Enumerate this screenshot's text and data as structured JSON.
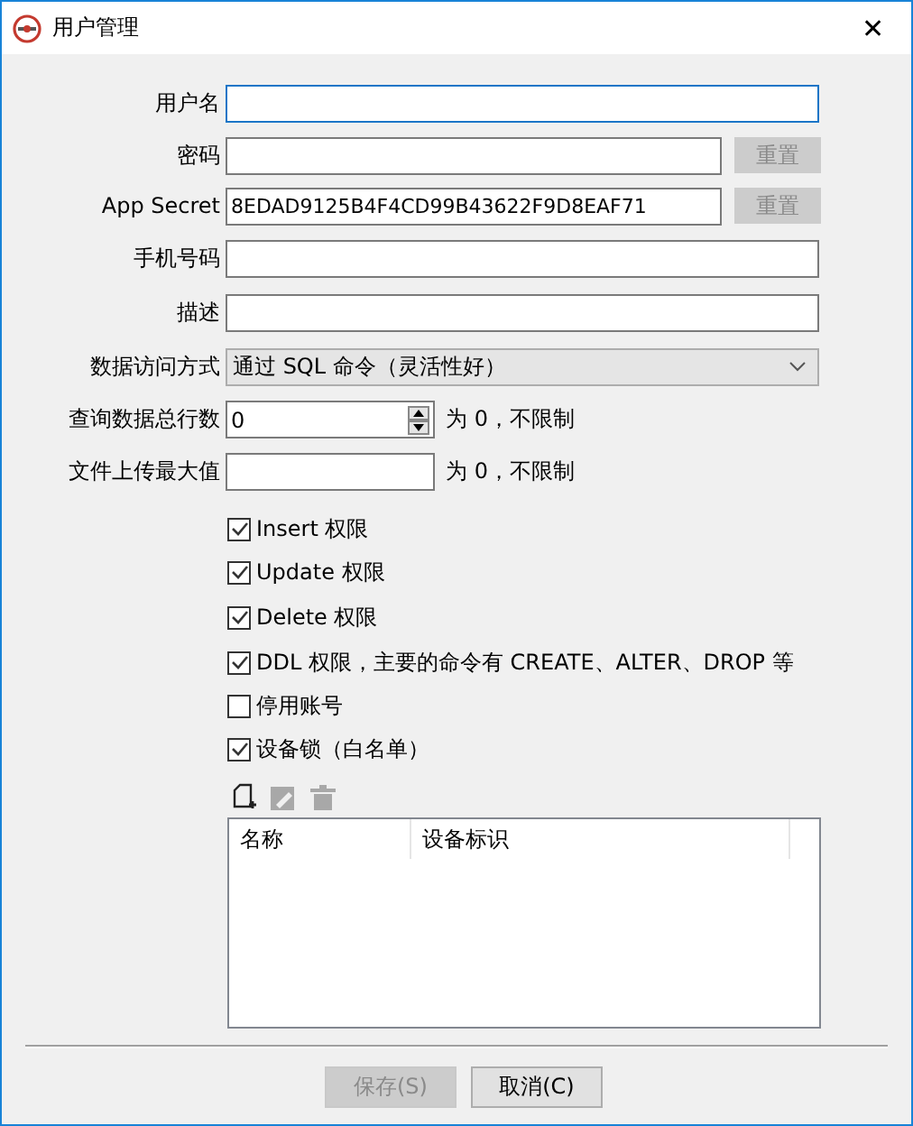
{
  "window": {
    "title": "用户管理",
    "close": "✕"
  },
  "fields": [
    {
      "kind": "text",
      "label": "用户名",
      "focused": true
    },
    {
      "kind": "button",
      "label": "密码",
      "button": {
        "label": "重置",
        "disabled": true
      }
    },
    {
      "kind": "button",
      "label": "App Secret",
      "value": "8EDAD9125B4F4CD99B43622F9D8EAF71",
      "button": {
        "label": "重置",
        "disabled": true
      }
    },
    {
      "kind": "text",
      "label": "手机号码"
    },
    {
      "kind": "text",
      "label": "描述"
    },
    {
      "kind": "combo",
      "label": "数据访问方式",
      "value": "通过 SQL 命令（灵活性好）"
    },
    {
      "kind": "spinner",
      "label": "查询数据总行数",
      "value": "0",
      "hint": "为 0，不限制"
    },
    {
      "kind": "text",
      "label": "文件上传最大值",
      "hint": "为 0，不限制"
    }
  ],
  "checkboxes": [
    {
      "label": "Insert 权限",
      "checked": true
    },
    {
      "label": "Update 权限",
      "checked": true
    },
    {
      "label": "Delete 权限",
      "checked": true
    },
    {
      "label": "DDL 权限，主要的命令有 CREATE、ALTER、DROP 等",
      "checked": true
    },
    {
      "label": "停用账号",
      "checked": false
    },
    {
      "label": "设备锁（白名单）",
      "checked": true
    }
  ],
  "toolbar": [
    {
      "kind": "add",
      "disabled": false
    },
    {
      "kind": "edit",
      "disabled": true
    },
    {
      "kind": "delete",
      "disabled": true
    }
  ],
  "table": {
    "columns": [
      "名称",
      "设备标识"
    ]
  },
  "buttons": [
    {
      "label": "保存(S)",
      "disabled": true
    },
    {
      "label": "取消(C)",
      "disabled": false
    }
  ]
}
